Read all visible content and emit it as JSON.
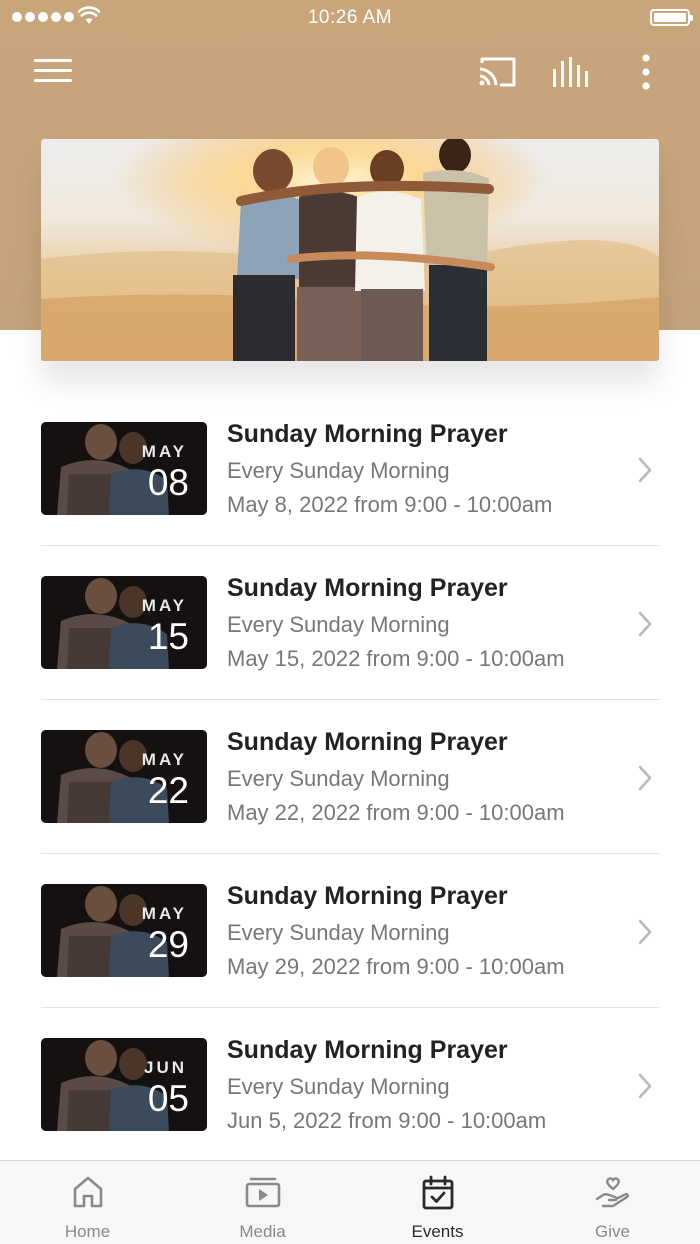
{
  "status_bar": {
    "time": "10:26 AM",
    "signal_icon": "signal-dots-icon",
    "wifi_icon": "wifi-icon",
    "battery_icon": "battery-icon"
  },
  "toolbar": {
    "menu_icon": "hamburger-menu-icon",
    "cast_icon": "cast-icon",
    "audio_icon": "audio-bars-icon",
    "more_icon": "more-vertical-icon"
  },
  "colors": {
    "header_background": "#c7a47c",
    "text_primary": "#222222",
    "text_secondary": "#777777",
    "tab_inactive": "#8a8a8a",
    "tab_active": "#2a2a2a"
  },
  "events": [
    {
      "month": "MAY",
      "day": "08",
      "title": "Sunday Morning Prayer",
      "subtitle": "Every Sunday Morning",
      "date_text": "May 8, 2022 from 9:00 - 10:00am"
    },
    {
      "month": "MAY",
      "day": "15",
      "title": "Sunday Morning Prayer",
      "subtitle": "Every Sunday Morning",
      "date_text": "May 15, 2022 from 9:00 - 10:00am"
    },
    {
      "month": "MAY",
      "day": "22",
      "title": "Sunday Morning Prayer",
      "subtitle": "Every Sunday Morning",
      "date_text": "May 22, 2022 from 9:00 - 10:00am"
    },
    {
      "month": "MAY",
      "day": "29",
      "title": "Sunday Morning Prayer",
      "subtitle": "Every Sunday Morning",
      "date_text": "May 29, 2022 from 9:00 - 10:00am"
    },
    {
      "month": "JUN",
      "day": "05",
      "title": "Sunday Morning Prayer",
      "subtitle": "Every Sunday Morning",
      "date_text": "Jun 5, 2022 from 9:00 - 10:00am"
    }
  ],
  "tabs": [
    {
      "label": "Home",
      "icon": "home-icon",
      "active": false
    },
    {
      "label": "Media",
      "icon": "media-play-icon",
      "active": false
    },
    {
      "label": "Events",
      "icon": "calendar-check-icon",
      "active": true
    },
    {
      "label": "Give",
      "icon": "give-hand-heart-icon",
      "active": false
    }
  ]
}
